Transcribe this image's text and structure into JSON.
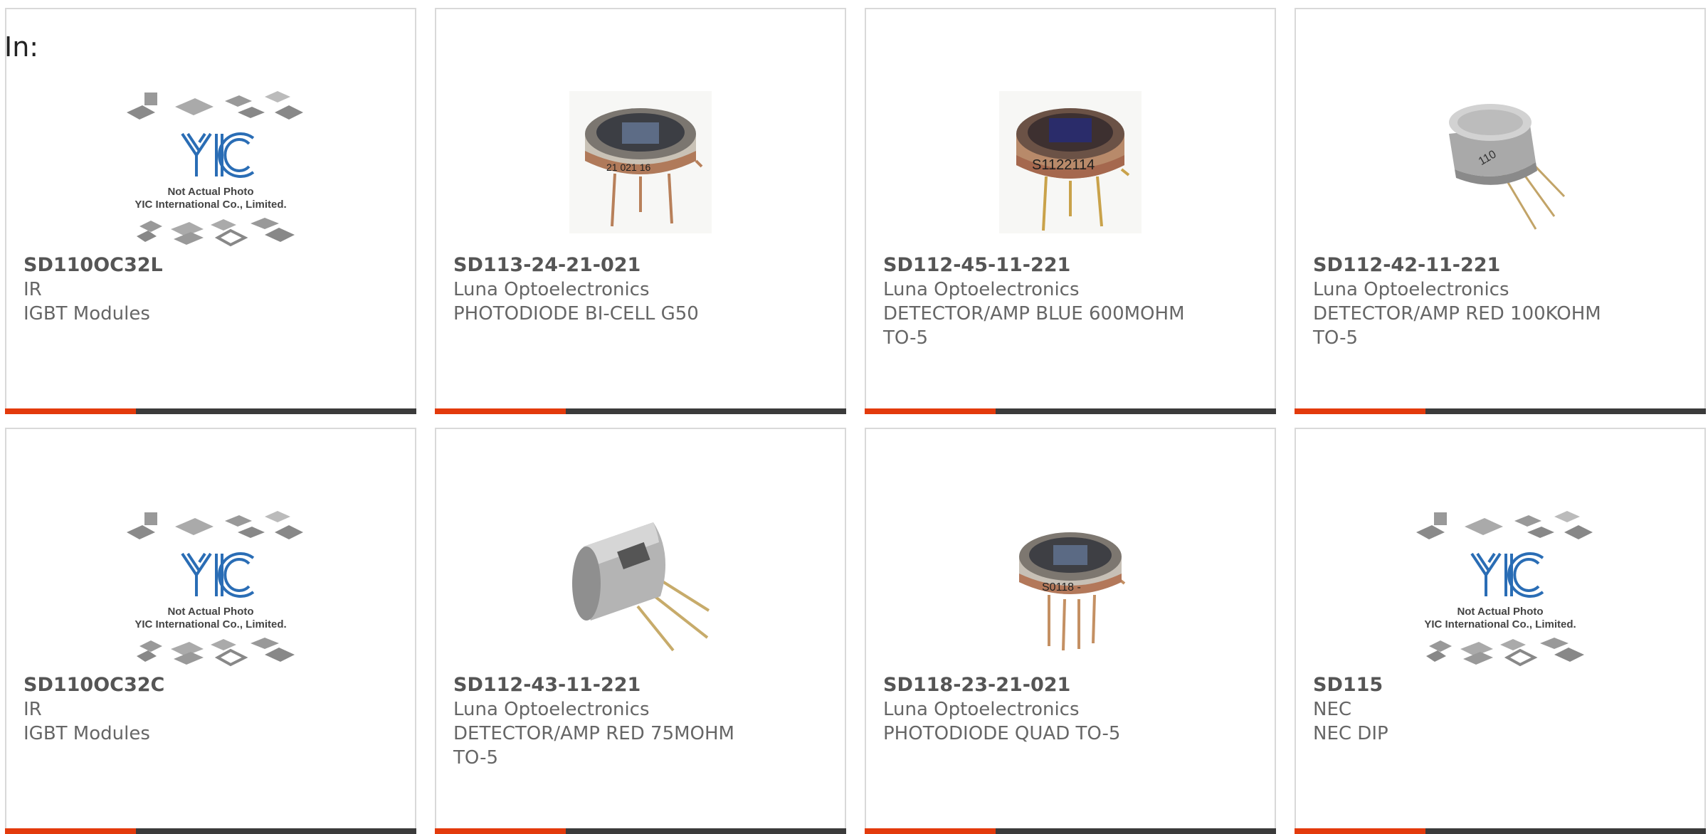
{
  "filter": {
    "label": "In:"
  },
  "placeholder_image": {
    "line1": "Not Actual Photo",
    "line2": "YIC International Co., Limited."
  },
  "colors": {
    "accent": "#e33a0c",
    "bar_dark": "#3b3b3b",
    "border": "#d9d9d9",
    "text": "#666666"
  },
  "products": [
    {
      "part": "SD110OC32L",
      "maker": "IR",
      "desc1": "IGBT Modules",
      "desc2": "",
      "image": "yic-placeholder-image"
    },
    {
      "part": "SD113-24-21-021",
      "maker": "Luna Optoelectronics",
      "desc1": "PHOTODIODE BI-CELL G50",
      "desc2": "",
      "image": "to5-photodiode-image"
    },
    {
      "part": "SD112-45-11-221",
      "maker": "Luna Optoelectronics",
      "desc1": "DETECTOR/AMP BLUE 600MOHM",
      "desc2": "TO-5",
      "image": "to5-detector-image"
    },
    {
      "part": "SD112-42-11-221",
      "maker": "Luna Optoelectronics",
      "desc1": "DETECTOR/AMP RED 100KOHM",
      "desc2": "TO-5",
      "image": "to5-can-image"
    },
    {
      "part": "SD110OC32C",
      "maker": "IR",
      "desc1": "IGBT Modules",
      "desc2": "",
      "image": "yic-placeholder-image"
    },
    {
      "part": "SD112-43-11-221",
      "maker": "Luna Optoelectronics",
      "desc1": "DETECTOR/AMP RED 75MOHM",
      "desc2": "TO-5",
      "image": "to5-can-side-image"
    },
    {
      "part": "SD118-23-21-021",
      "maker": "Luna Optoelectronics",
      "desc1": "PHOTODIODE QUAD TO-5",
      "desc2": "",
      "image": "to5-photodiode-quad-image"
    },
    {
      "part": "SD115",
      "maker": "NEC",
      "desc1": "NEC DIP",
      "desc2": "",
      "image": "yic-placeholder-image"
    }
  ]
}
